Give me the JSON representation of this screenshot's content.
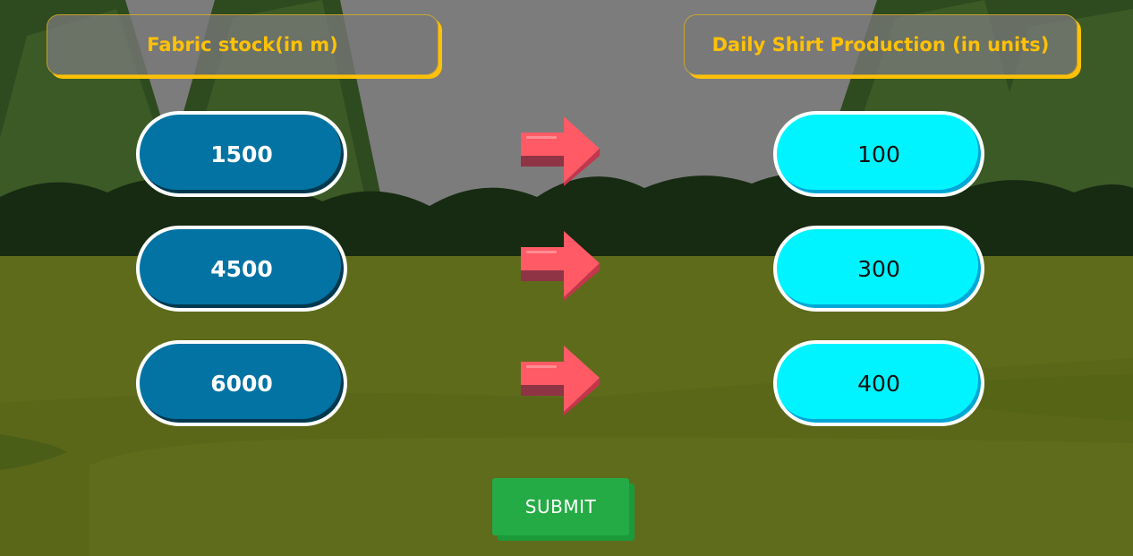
{
  "headers": {
    "left": "Fabric stock(in m)",
    "right": "Daily Shirt Production (in units)"
  },
  "rows": [
    {
      "left": "1500",
      "right": "100"
    },
    {
      "left": "4500",
      "right": "300"
    },
    {
      "left": "6000",
      "right": "400"
    }
  ],
  "submit_label": "SUBMIT",
  "colors": {
    "header_text": "#ffc107",
    "left_pill": "#0273a3",
    "right_pill": "#00f4ff",
    "arrow": "#ff5a66",
    "submit": "#25ab45"
  }
}
